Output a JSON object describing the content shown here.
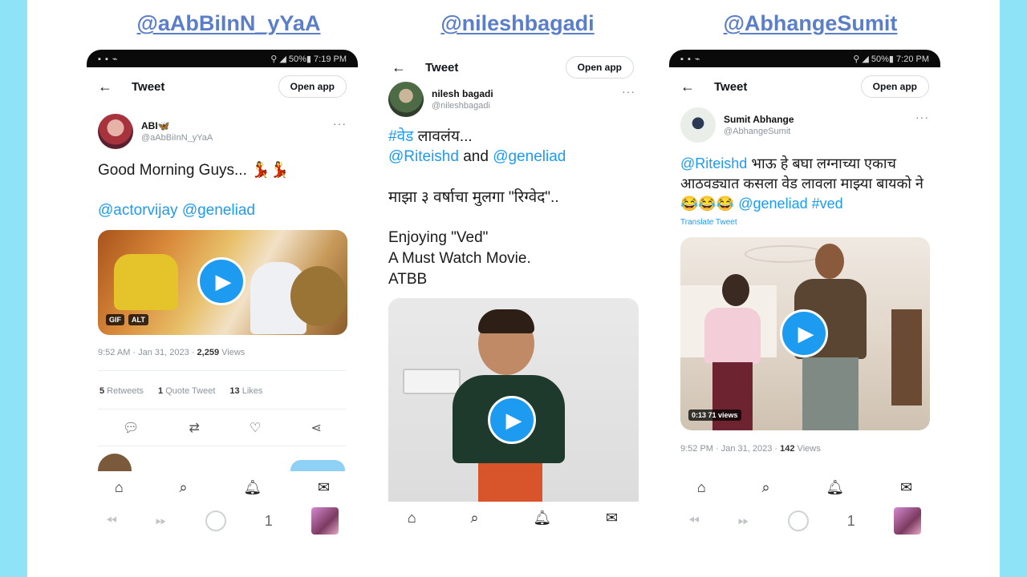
{
  "columns": [
    {
      "handle": "@aAbBiInN_yYaA",
      "status_time": "7:19 PM",
      "status_battery": "50%",
      "topbar": {
        "title": "Tweet",
        "open_app": "Open app"
      },
      "author": {
        "name": "ABI🦋",
        "handle": "@aAbBiInN_yYaA"
      },
      "text": "Good Morning Guys... 💃💃",
      "mentions": "@actorvijay @geneliad",
      "media": {
        "badge_gif": "GIF",
        "badge_alt": "ALT"
      },
      "meta": {
        "time": "9:52 AM · Jan 31, 2023 · ",
        "views": "2,259",
        "views_label": " Views"
      },
      "stats": {
        "retweets": "5",
        "retweets_label": " Retweets",
        "quotes": "1",
        "quotes_label": " Quote Tweet",
        "likes": "13",
        "likes_label": " Likes"
      }
    },
    {
      "handle": "@nileshbagadi",
      "topbar": {
        "title": "Tweet",
        "open_app": "Open app"
      },
      "author": {
        "name": "nilesh bagadi",
        "handle": "@nileshbagadi"
      },
      "hashtag": "#वेड",
      "hashtag_rest": " लावलंय...",
      "mention1": "@Riteishd",
      "and_text": "  and ",
      "mention2": "@geneliad",
      "line2": "माझा ३ वर्षाचा मुलगा \"रिग्वेद\"..",
      "line3": "Enjoying \"Ved\"\nA Must Watch Movie.\nATBB"
    },
    {
      "handle": "@AbhangeSumit",
      "status_time": "7:20 PM",
      "status_battery": "50%",
      "topbar": {
        "title": "Tweet",
        "open_app": "Open app"
      },
      "author": {
        "name": "Sumit Abhange",
        "handle": "@AbhangeSumit"
      },
      "mention": "@Riteishd",
      "text": " भाऊ हे बघा लग्नाच्या एकाच आठवड्यात कसला वेड लावला माझ्या बायको ने😂😂😂 ",
      "mention2": "@geneliad",
      "hashtag": " #ved",
      "translate": "Translate Tweet",
      "media": {
        "duration": "0:13",
        "views": "71 views"
      },
      "meta": {
        "time": "9:52 PM · Jan 31, 2023 · ",
        "views": "142",
        "views_label": " Views"
      }
    }
  ],
  "nav_icons": [
    "home-icon",
    "search-icon",
    "notifications-icon",
    "messages-icon"
  ],
  "system_bar": {
    "tab_count": "1"
  },
  "colors": {
    "accent": "#1d9bf0",
    "handle_title": "#5b7ec9",
    "side_bar": "#8fe3f6"
  }
}
